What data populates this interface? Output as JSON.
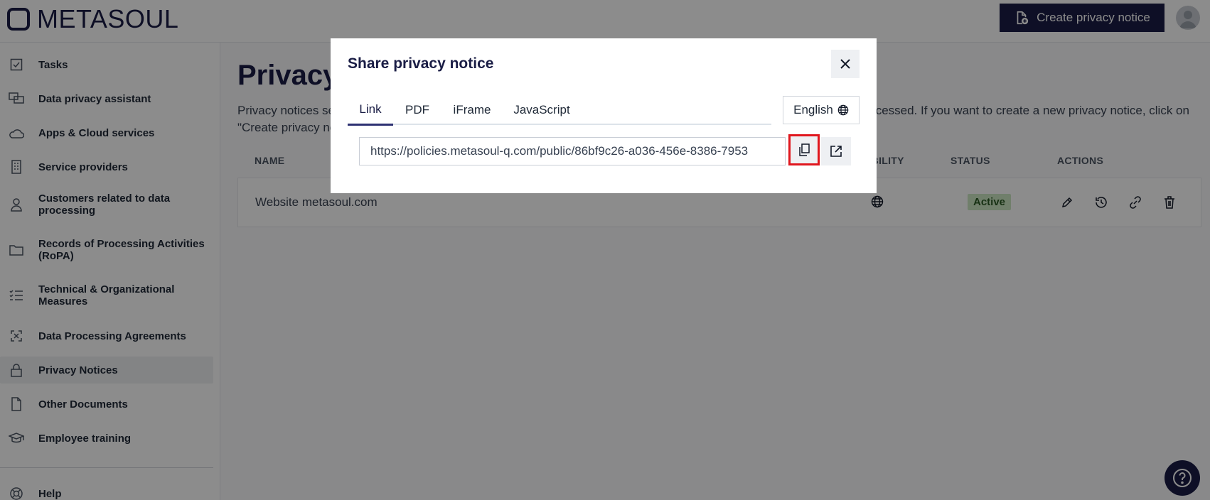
{
  "header": {
    "logo_text": "METASOUL",
    "create_button": "Create privacy notice"
  },
  "sidebar": {
    "items": [
      {
        "label": "Tasks",
        "icon": "checkbox-icon"
      },
      {
        "label": "Data privacy assistant",
        "icon": "chat-icon"
      },
      {
        "label": "Apps & Cloud services",
        "icon": "cloud-icon"
      },
      {
        "label": "Service providers",
        "icon": "building-icon"
      },
      {
        "label": "Customers related to data processing",
        "icon": "person-icon"
      },
      {
        "label": "Records of Processing Activities (RoPA)",
        "icon": "folder-icon"
      },
      {
        "label": "Technical & Organizational Measures",
        "icon": "checklist-icon"
      },
      {
        "label": "Data Processing Agreements",
        "icon": "agreement-icon"
      },
      {
        "label": "Privacy Notices",
        "icon": "lock-icon",
        "active": true
      },
      {
        "label": "Other Documents",
        "icon": "document-icon"
      },
      {
        "label": "Employee training",
        "icon": "graduation-cap-icon"
      }
    ],
    "help_label": "Help"
  },
  "main": {
    "title": "Privacy notices",
    "description": "Privacy notices serve to fulfill the information obligations towards data subjects that arise whenever personal data is processed. If you want to create a new privacy notice, click on \"Create privacy notice\".",
    "columns": [
      "NAME",
      "VISIBILITY",
      "STATUS",
      "ACTIONS"
    ],
    "rows": [
      {
        "name": "Website metasoul.com",
        "status": "Active"
      }
    ]
  },
  "modal": {
    "title": "Share privacy notice",
    "tabs": [
      "Link",
      "PDF",
      "iFrame",
      "JavaScript"
    ],
    "active_tab": "Link",
    "language": "English",
    "url": "https://policies.metasoul-q.com/public/86bf9c26-a036-456e-8386-7953"
  },
  "colors": {
    "brand_navy": "#1a1d45",
    "status_active_bg": "#cde7c4",
    "highlight_red": "#e0161d"
  }
}
